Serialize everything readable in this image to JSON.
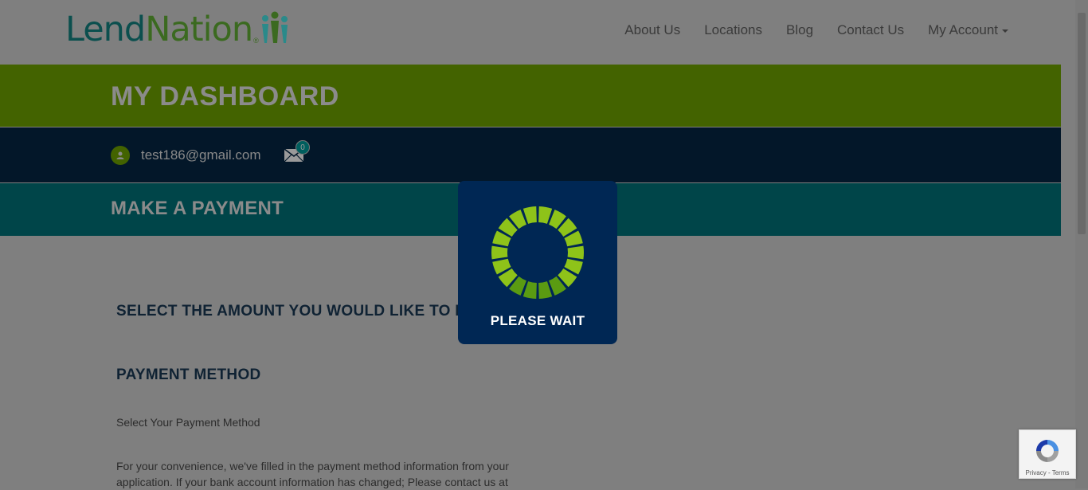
{
  "header": {
    "logo_part1": "Lend",
    "logo_part2": "Nation",
    "logo_reg": "®",
    "nav": [
      "About Us",
      "Locations",
      "Blog",
      "Contact Us",
      "My Account"
    ]
  },
  "dashboard": {
    "title": "MY DASHBOARD"
  },
  "user": {
    "email": "test186@gmail.com",
    "message_count": "0"
  },
  "payment": {
    "title": "MAKE A PAYMENT",
    "select_amount_heading": "SELECT THE AMOUNT YOU WOULD LIKE TO PA",
    "method_heading": "PAYMENT METHOD",
    "method_subtitle": "Select Your Payment Method",
    "convenience_text": "For your convenience, we've filled in the payment method information from your application. If your bank account information has changed; Please contact us at"
  },
  "modal": {
    "text": "PLEASE WAIT"
  },
  "recaptcha": {
    "links": "Privacy - Terms"
  },
  "colors": {
    "dashboard_band": "#436300",
    "user_band": "#031729",
    "payment_band": "#004549",
    "modal_bg": "#002754",
    "spinner_light": "#8ec319",
    "spinner_dark": "#5a9b12"
  }
}
